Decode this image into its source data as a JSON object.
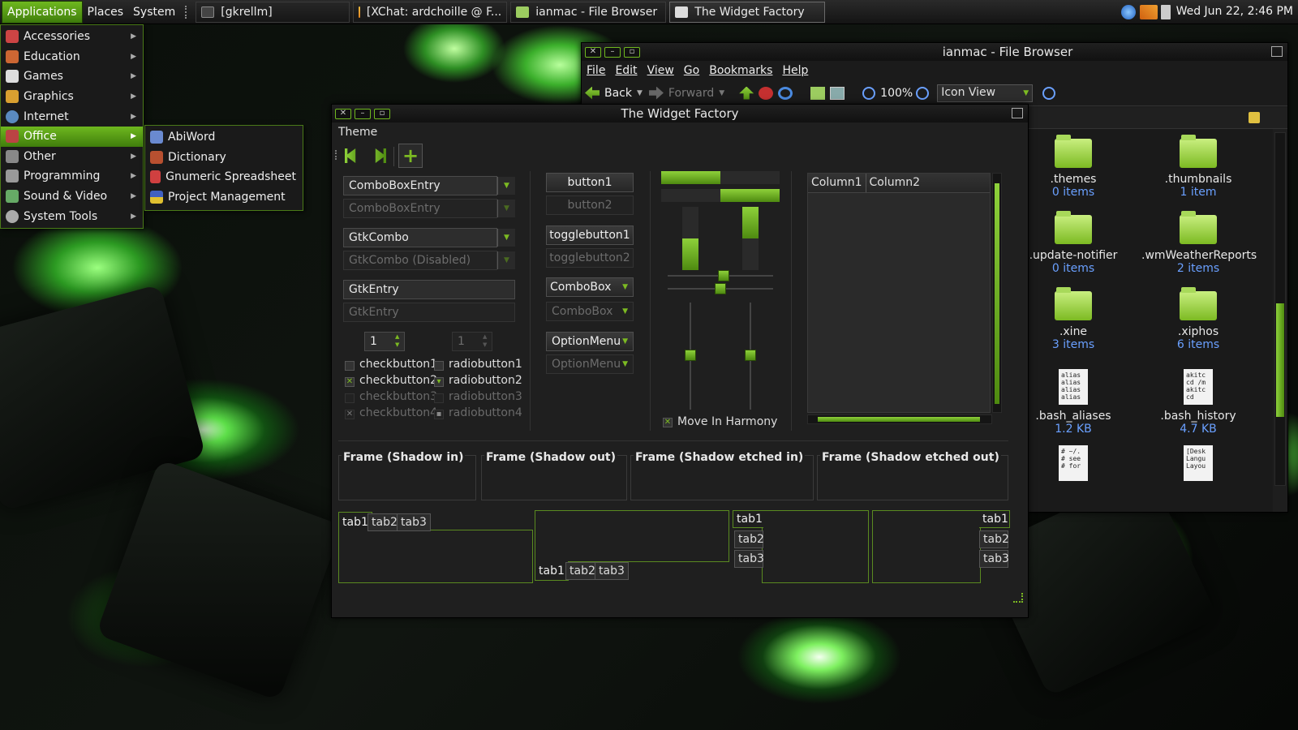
{
  "panel": {
    "menus": [
      "Applications",
      "Places",
      "System"
    ],
    "tasks": [
      "[gkrellm]",
      "[XChat: ardchoille @ F...",
      "ianmac - File Browser",
      "The Widget Factory"
    ],
    "clock": "Wed Jun 22,  2:46 PM"
  },
  "app_menu": {
    "items": [
      "Accessories",
      "Education",
      "Games",
      "Graphics",
      "Internet",
      "Office",
      "Other",
      "Programming",
      "Sound & Video",
      "System Tools"
    ],
    "highlighted": "Office",
    "submenu": [
      "AbiWord",
      "Dictionary",
      "Gnumeric Spreadsheet",
      "Project Management"
    ]
  },
  "file_browser": {
    "title": "ianmac - File Browser",
    "menubar": [
      "File",
      "Edit",
      "View",
      "Go",
      "Bookmarks",
      "Help"
    ],
    "toolbar": {
      "back": "Back",
      "forward": "Forward",
      "zoom": "100%",
      "view_mode": "Icon View"
    },
    "items": [
      {
        "name": ".themes",
        "info": "0 items"
      },
      {
        "name": ".thumbnails",
        "info": "1 item"
      },
      {
        "name": ".update-notifier",
        "info": "0 items"
      },
      {
        "name": ".wmWeatherReports",
        "info": "2 items"
      },
      {
        "name": ".xine",
        "info": "3 items"
      },
      {
        "name": ".xiphos",
        "info": "6 items"
      },
      {
        "name": ".bash_aliases",
        "info": "1.2 KB"
      },
      {
        "name": ".bash_history",
        "info": "4.7 KB"
      }
    ],
    "file_previews": {
      "bash_aliases": "alias\nalias\nalias\nalias",
      "bash_history": "akitc\ncd /m\nakitc\ncd",
      "profile": "# ~/.\n# see\n# for",
      "desktop": "[Desk\nLangu\nLayou"
    }
  },
  "widget_factory": {
    "title": "The Widget Factory",
    "menu_theme": "Theme",
    "combo_entry": "ComboBoxEntry",
    "combo_entry_dis": "ComboBoxEntry",
    "gtk_combo": "GtkCombo",
    "gtk_combo_dis": "GtkCombo (Disabled)",
    "gtk_entry": "GtkEntry",
    "gtk_entry_dis": "GtkEntry",
    "spin1": "1",
    "spin2": "1",
    "checks": [
      "checkbutton1",
      "checkbutton2",
      "checkbutton3",
      "checkbutton4"
    ],
    "radios": [
      "radiobutton1",
      "radiobutton2",
      "radiobutton3",
      "radiobutton4"
    ],
    "button1": "button1",
    "button2": "button2",
    "toggle1": "togglebutton1",
    "toggle2": "togglebutton2",
    "combobox": "ComboBox",
    "combobox_dis": "ComboBox",
    "optionmenu": "OptionMenu",
    "optionmenu_dis": "OptionMenu",
    "move_harmony": "Move In Harmony",
    "columns": [
      "Column1",
      "Column2"
    ],
    "frames": [
      "Frame (Shadow in)",
      "Frame (Shadow out)",
      "Frame (Shadow etched in)",
      "Frame (Shadow etched out)"
    ],
    "tabs": [
      "tab1",
      "tab2",
      "tab3"
    ]
  },
  "colors": {
    "accent": "#7cba22",
    "highlight": "#5a9a15",
    "link": "#6aa0ff"
  }
}
